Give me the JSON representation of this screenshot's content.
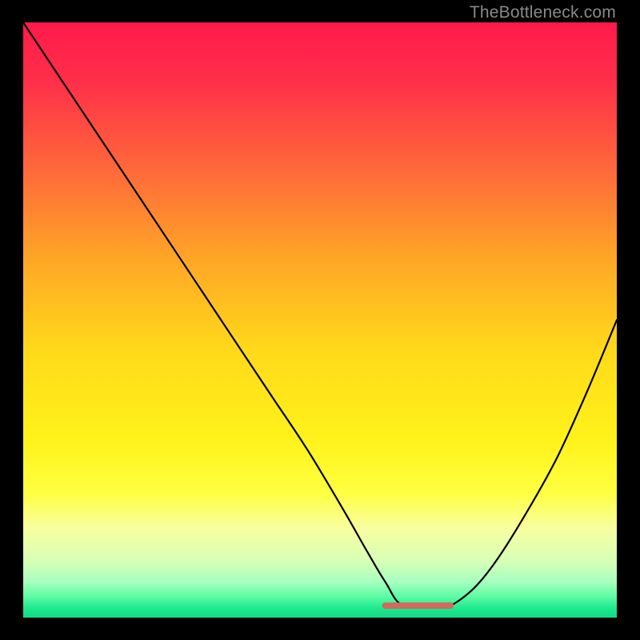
{
  "watermark": "TheBottleneck.com",
  "colors": {
    "bg": "#000000",
    "curve_stroke": "#000000",
    "flat_segment": "#d16a5f",
    "gradient_stops": [
      {
        "offset": 0.0,
        "color": "#ff1a4b"
      },
      {
        "offset": 0.1,
        "color": "#ff2f49"
      },
      {
        "offset": 0.25,
        "color": "#ff6a3a"
      },
      {
        "offset": 0.4,
        "color": "#ffa726"
      },
      {
        "offset": 0.55,
        "color": "#ffd91a"
      },
      {
        "offset": 0.7,
        "color": "#fff21a"
      },
      {
        "offset": 0.79,
        "color": "#ffff40"
      },
      {
        "offset": 0.85,
        "color": "#f8ffa0"
      },
      {
        "offset": 0.905,
        "color": "#d7ffb6"
      },
      {
        "offset": 0.94,
        "color": "#a6ffc0"
      },
      {
        "offset": 0.965,
        "color": "#5cfca3"
      },
      {
        "offset": 0.985,
        "color": "#1de890"
      },
      {
        "offset": 1.0,
        "color": "#0fdb85"
      }
    ]
  },
  "chart_data": {
    "type": "line",
    "title": "",
    "xlabel": "",
    "ylabel": "",
    "xlim": [
      0,
      100
    ],
    "ylim": [
      0,
      100
    ],
    "grid": false,
    "series": [
      {
        "name": "bottleneck-curve",
        "x": [
          0,
          6,
          12,
          18,
          24,
          30,
          36,
          42,
          48,
          54,
          58,
          61,
          64,
          70,
          72,
          76,
          80,
          85,
          90,
          95,
          100
        ],
        "values": [
          100,
          91,
          82,
          73,
          64,
          55,
          46,
          37,
          28,
          18,
          11,
          6,
          2,
          2,
          2,
          5,
          10,
          18,
          27,
          38,
          50
        ]
      }
    ],
    "annotations": [
      {
        "name": "optimal-flat-segment",
        "x_start": 61,
        "x_end": 72,
        "y": 2
      }
    ]
  }
}
